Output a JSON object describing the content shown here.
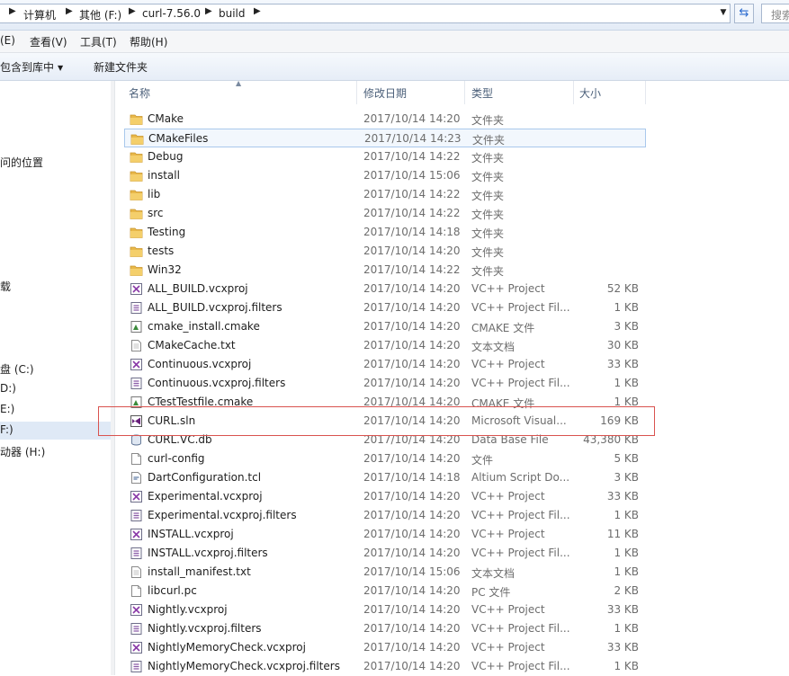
{
  "address": {
    "crumbs": [
      "计算机",
      "其他 (F:)",
      "curl-7.56.0",
      "build"
    ],
    "search_placeholder": "搜索"
  },
  "menu": [
    "(E)",
    "查看(V)",
    "工具(T)",
    "帮助(H)"
  ],
  "commands": {
    "include_library": "包含到库中",
    "new_folder": "新建文件夹"
  },
  "nav": [
    {
      "label": "问的位置"
    },
    {
      "label": "载"
    },
    {
      "label": "盘 (C:)"
    },
    {
      "label": "D:)"
    },
    {
      "label": "E:)"
    },
    {
      "label": "F:)"
    },
    {
      "label": "动器 (H:)"
    }
  ],
  "columns": {
    "name": "名称",
    "date": "修改日期",
    "type": "类型",
    "size": "大小"
  },
  "files": [
    {
      "name": "CMake",
      "date": "2017/10/14 14:20",
      "type": "文件夹",
      "size": "",
      "icon": "folder-icon"
    },
    {
      "name": "CMakeFiles",
      "date": "2017/10/14 14:23",
      "type": "文件夹",
      "size": "",
      "icon": "folder-icon"
    },
    {
      "name": "Debug",
      "date": "2017/10/14 14:22",
      "type": "文件夹",
      "size": "",
      "icon": "folder-icon"
    },
    {
      "name": "install",
      "date": "2017/10/14 15:06",
      "type": "文件夹",
      "size": "",
      "icon": "folder-icon"
    },
    {
      "name": "lib",
      "date": "2017/10/14 14:22",
      "type": "文件夹",
      "size": "",
      "icon": "folder-icon"
    },
    {
      "name": "src",
      "date": "2017/10/14 14:22",
      "type": "文件夹",
      "size": "",
      "icon": "folder-icon"
    },
    {
      "name": "Testing",
      "date": "2017/10/14 14:18",
      "type": "文件夹",
      "size": "",
      "icon": "folder-icon"
    },
    {
      "name": "tests",
      "date": "2017/10/14 14:20",
      "type": "文件夹",
      "size": "",
      "icon": "folder-icon"
    },
    {
      "name": "Win32",
      "date": "2017/10/14 14:22",
      "type": "文件夹",
      "size": "",
      "icon": "folder-icon"
    },
    {
      "name": "ALL_BUILD.vcxproj",
      "date": "2017/10/14 14:20",
      "type": "VC++ Project",
      "size": "52 KB",
      "icon": "vcxproj-icon"
    },
    {
      "name": "ALL_BUILD.vcxproj.filters",
      "date": "2017/10/14 14:20",
      "type": "VC++ Project Fil...",
      "size": "1 KB",
      "icon": "filters-icon"
    },
    {
      "name": "cmake_install.cmake",
      "date": "2017/10/14 14:20",
      "type": "CMAKE 文件",
      "size": "3 KB",
      "icon": "cmake-file-icon"
    },
    {
      "name": "CMakeCache.txt",
      "date": "2017/10/14 14:20",
      "type": "文本文档",
      "size": "30 KB",
      "icon": "text-file-icon"
    },
    {
      "name": "Continuous.vcxproj",
      "date": "2017/10/14 14:20",
      "type": "VC++ Project",
      "size": "33 KB",
      "icon": "vcxproj-icon"
    },
    {
      "name": "Continuous.vcxproj.filters",
      "date": "2017/10/14 14:20",
      "type": "VC++ Project Fil...",
      "size": "1 KB",
      "icon": "filters-icon"
    },
    {
      "name": "CTestTestfile.cmake",
      "date": "2017/10/14 14:20",
      "type": "CMAKE 文件",
      "size": "1 KB",
      "icon": "cmake-file-icon"
    },
    {
      "name": "CURL.sln",
      "date": "2017/10/14 14:20",
      "type": "Microsoft Visual...",
      "size": "169 KB",
      "icon": "visual-studio-solution-icon"
    },
    {
      "name": "CURL.VC.db",
      "date": "2017/10/14 14:20",
      "type": "Data Base File",
      "size": "43,380 KB",
      "icon": "database-file-icon"
    },
    {
      "name": "curl-config",
      "date": "2017/10/14 14:20",
      "type": "文件",
      "size": "5 KB",
      "icon": "blank-file-icon"
    },
    {
      "name": "DartConfiguration.tcl",
      "date": "2017/10/14 14:18",
      "type": "Altium Script Do...",
      "size": "3 KB",
      "icon": "script-file-icon"
    },
    {
      "name": "Experimental.vcxproj",
      "date": "2017/10/14 14:20",
      "type": "VC++ Project",
      "size": "33 KB",
      "icon": "vcxproj-icon"
    },
    {
      "name": "Experimental.vcxproj.filters",
      "date": "2017/10/14 14:20",
      "type": "VC++ Project Fil...",
      "size": "1 KB",
      "icon": "filters-icon"
    },
    {
      "name": "INSTALL.vcxproj",
      "date": "2017/10/14 14:20",
      "type": "VC++ Project",
      "size": "11 KB",
      "icon": "vcxproj-icon"
    },
    {
      "name": "INSTALL.vcxproj.filters",
      "date": "2017/10/14 14:20",
      "type": "VC++ Project Fil...",
      "size": "1 KB",
      "icon": "filters-icon"
    },
    {
      "name": "install_manifest.txt",
      "date": "2017/10/14 15:06",
      "type": "文本文档",
      "size": "1 KB",
      "icon": "text-file-icon"
    },
    {
      "name": "libcurl.pc",
      "date": "2017/10/14 14:20",
      "type": "PC 文件",
      "size": "2 KB",
      "icon": "blank-file-icon"
    },
    {
      "name": "Nightly.vcxproj",
      "date": "2017/10/14 14:20",
      "type": "VC++ Project",
      "size": "33 KB",
      "icon": "vcxproj-icon"
    },
    {
      "name": "Nightly.vcxproj.filters",
      "date": "2017/10/14 14:20",
      "type": "VC++ Project Fil...",
      "size": "1 KB",
      "icon": "filters-icon"
    },
    {
      "name": "NightlyMemoryCheck.vcxproj",
      "date": "2017/10/14 14:20",
      "type": "VC++ Project",
      "size": "33 KB",
      "icon": "vcxproj-icon"
    },
    {
      "name": "NightlyMemoryCheck.vcxproj.filters",
      "date": "2017/10/14 14:20",
      "type": "VC++ Project Fil...",
      "size": "1 KB",
      "icon": "filters-icon"
    }
  ],
  "colors": {
    "highlight_border": "#d9534f",
    "row_hover": "#a9c8ec",
    "folder": "#e8b84a"
  }
}
